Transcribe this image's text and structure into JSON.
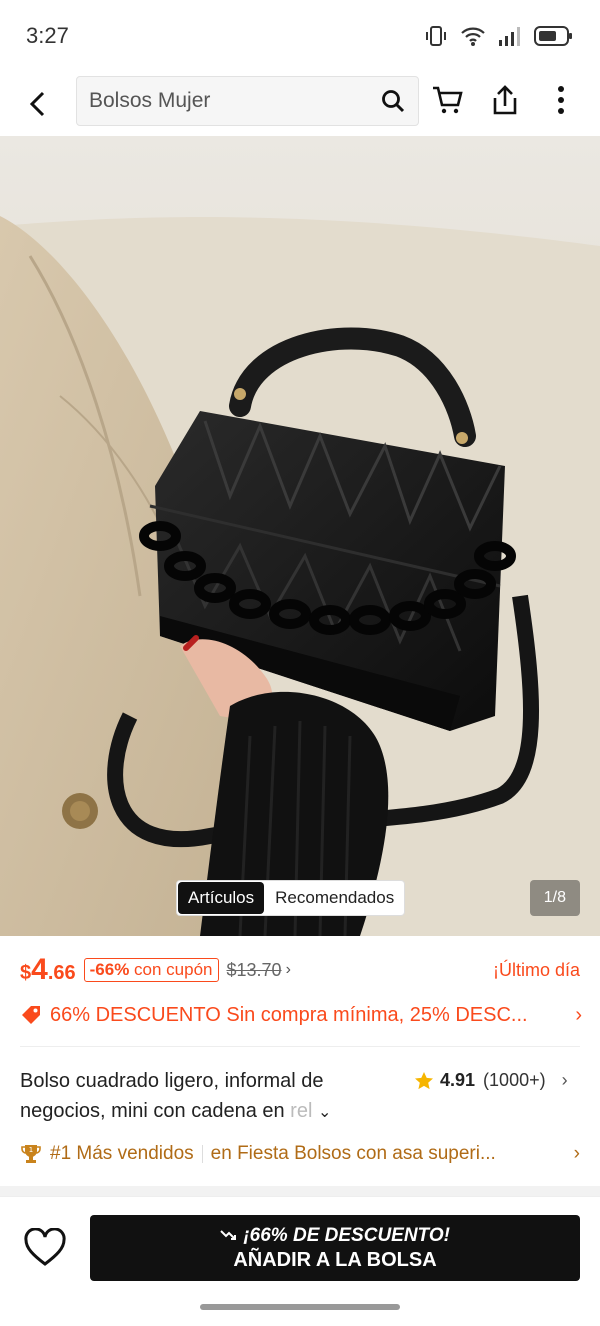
{
  "status": {
    "time": "3:27"
  },
  "search": {
    "placeholder": "Bolsos Mujer"
  },
  "hero": {
    "tabs": [
      {
        "label": "Artículos",
        "active": true
      },
      {
        "label": "Recomendados",
        "active": false
      }
    ],
    "counter": "1/8"
  },
  "price": {
    "currency": "$",
    "integer": "4",
    "decimal": ".66",
    "discount": "-66%",
    "coupon_label": "con cupón",
    "original": "$13.70",
    "urgency": "¡Último día"
  },
  "promo": {
    "text": "66% DESCUENTO Sin compra mínima,  25% DESC..."
  },
  "product": {
    "title_line1": "Bolso cuadrado ligero, informal de",
    "title_line2": "negocios, mini con cadena en",
    "title_fade": " rel",
    "rating": "4.91",
    "review_count": "(1000+)"
  },
  "ranking": {
    "badge": "#1 Más vendidos",
    "category": "en Fiesta Bolsos con asa superi..."
  },
  "cta": {
    "promo": "¡66% DE DESCUENTO!",
    "label": "AÑADIR A LA BOLSA"
  },
  "colors": {
    "accent": "#fa4a1c",
    "rank": "#b06b16",
    "cta_bg": "#111111"
  },
  "icons": [
    "back-icon",
    "search-icon",
    "cart-icon",
    "share-icon",
    "more-icon",
    "tag-icon",
    "star-icon",
    "trophy-icon",
    "heart-icon",
    "trend-icon"
  ]
}
